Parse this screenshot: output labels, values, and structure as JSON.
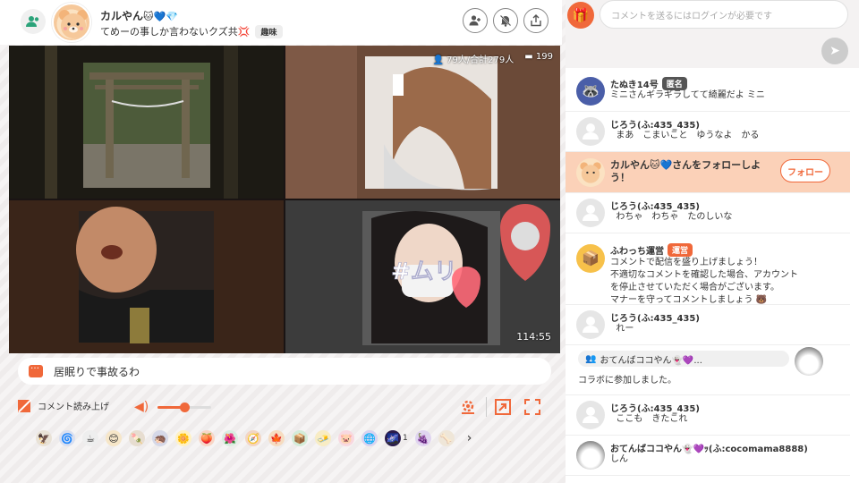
{
  "header": {
    "streamer_name": "カルやん",
    "streamer_emoji": "🐱💙💎",
    "subtitle": "てめーの事しか言わないクズ共",
    "subtitle_emoji": "💢",
    "hobby_badge": "趣味"
  },
  "video": {
    "viewers": "79人/合計279人",
    "comments": "199",
    "elapsed": "114:55",
    "overlay_text": "#ムリ"
  },
  "comment_bar": {
    "text": "居眠りで事故るわ"
  },
  "controls": {
    "read_aloud_label": "コメント読み上げ",
    "volume": 0.5
  },
  "gifts": {
    "items": [
      "🦅",
      "🌀",
      "☕",
      "😊",
      "🍡",
      "🦔",
      "🌼",
      "🍑",
      "🌺",
      "🧭",
      "🍁",
      "📦",
      "🧈",
      "🐷",
      "🌐",
      "🌌",
      "🍇",
      "🦴"
    ],
    "count_label": "1"
  },
  "chat": {
    "input_placeholder": "コメントを送るにはログインが必要です",
    "items": [
      {
        "type": "comment",
        "name": "たぬき14号",
        "badge": "匿名",
        "text": "ミニさんギラギラしてて綺麗だよ ミニ"
      },
      {
        "type": "comment",
        "name": "じろう(ふ:435_435)",
        "text": "  まあ　こまいこと　ゆうなよ　かる"
      },
      {
        "type": "follow",
        "text": "カルやん🐱💙さんをフォローしよう！",
        "button": "フォロー"
      },
      {
        "type": "comment",
        "name": "じろう(ふ:435_435)",
        "text": "  わちゃ　わちゃ　たのしいな"
      },
      {
        "type": "staff",
        "name": "ふわっち運営",
        "badge": "運営",
        "text": "コメントで配信を盛り上げましょう！\n不適切なコメントを確認した場合、アカウント\nを停止させていただく場合がございます。\nマナーを守ってコメントしましょう 🐻"
      },
      {
        "type": "comment",
        "name": "じろう(ふ:435_435)",
        "text": "  れー"
      },
      {
        "type": "collab",
        "name": "おてんばココやん👻💜...",
        "text": "コラボに参加しました。"
      },
      {
        "type": "comment",
        "name": "じろう(ふ:435_435)",
        "text": "  ここも　きたこれ"
      },
      {
        "type": "comment",
        "name": "おてんばココやん👻💜ｯ(ふ:cocomama8888)",
        "text": "しん"
      }
    ]
  }
}
